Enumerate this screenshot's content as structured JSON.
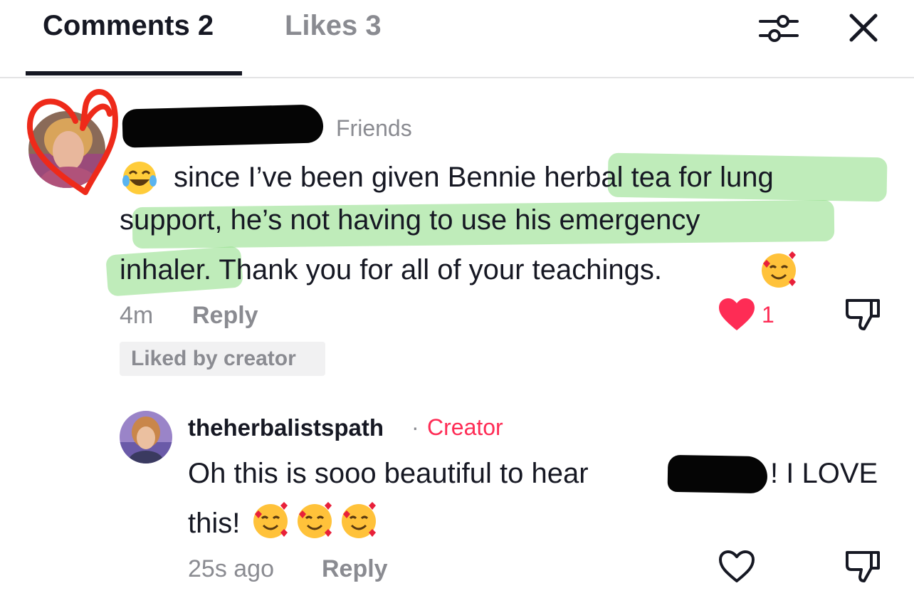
{
  "tabs": {
    "comments_label": "Comments 2",
    "likes_label": "Likes 3",
    "active": "comments"
  },
  "header_icons": [
    "sliders-icon",
    "close-icon"
  ],
  "comment1": {
    "badge": "Friends",
    "text_line1": "since I’ve been given Bennie herbal tea for lung",
    "text_line2": "support, he’s not having to use his emergency",
    "text_line3": "inhaler. Thank you for all of your teachings.",
    "time": "4m",
    "reply_label": "Reply",
    "like_count": "1",
    "liked_by_label": "Liked by creator"
  },
  "reply1": {
    "username": "theherbalistspath",
    "separator": "·",
    "role": "Creator",
    "text_line1a": "Oh this is sooo beautiful to hear",
    "text_line1b": "! I LOVE",
    "text_line2": "this!",
    "time": "25s ago",
    "reply_label": "Reply"
  },
  "colors": {
    "accent": "#fe2c55",
    "text": "#161823",
    "muted": "#8a8b91",
    "highlight": "#8adc82"
  }
}
